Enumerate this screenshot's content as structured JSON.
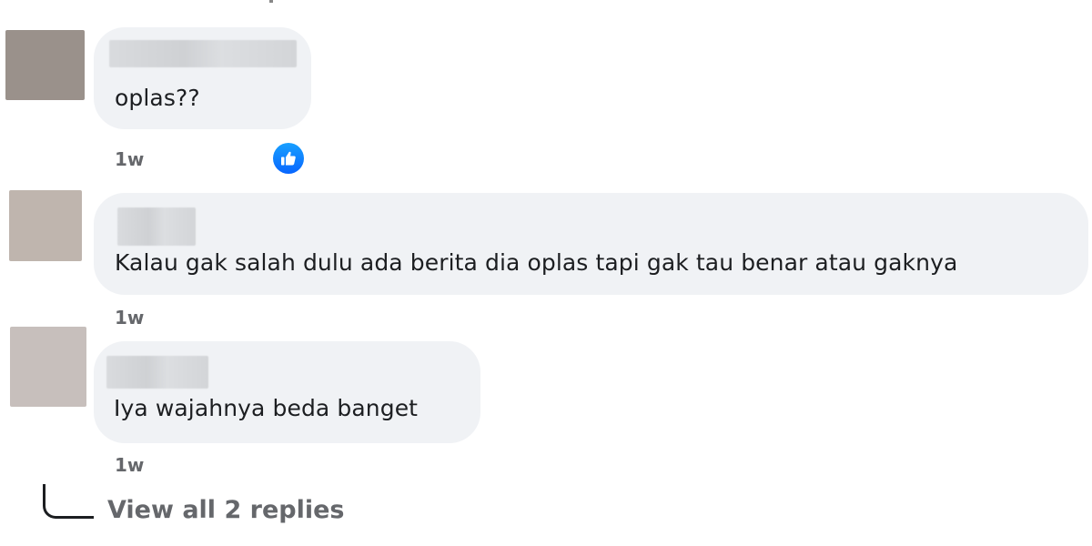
{
  "comments": [
    {
      "text": "oplas??",
      "time": "1w",
      "avatar_color": "#9a918b",
      "has_like": true
    },
    {
      "text": "Kalau gak salah dulu ada berita dia oplas tapi gak tau benar atau gaknya",
      "time": "1w",
      "avatar_color": "#bfb5ae",
      "has_like": false
    },
    {
      "text": "Iya wajahnya beda banget",
      "time": "1w",
      "avatar_color": "#c7bfbc",
      "has_like": false
    }
  ],
  "replies": {
    "label": "View all 2 replies"
  },
  "reaction": {
    "icon": "like-icon",
    "color": "#0866ff"
  },
  "colors": {
    "bubble": "#f0f2f5",
    "text": "#1c1e21",
    "muted": "#65676b"
  }
}
